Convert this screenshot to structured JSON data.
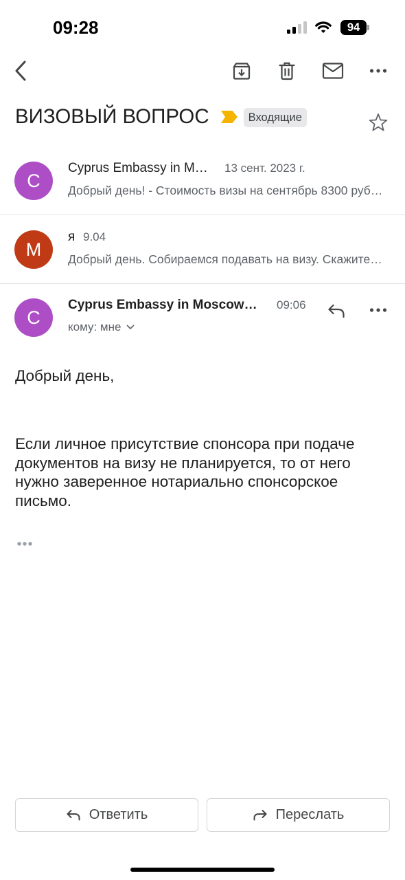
{
  "status_bar": {
    "time": "09:28",
    "battery_level": "94",
    "signal_icon": "cellular-signal-icon",
    "wifi_icon": "wifi-icon",
    "battery_icon": "battery-icon"
  },
  "toolbar": {
    "back_icon": "chevron-left-icon",
    "archive_icon": "archive-icon",
    "delete_icon": "trash-icon",
    "mark_unread_icon": "mail-icon",
    "more_icon": "more-horizontal-icon"
  },
  "thread": {
    "subject": "ВИЗОВЫЙ ВОПРОС",
    "importance_marker_color": "#f4b400",
    "label": "Входящие",
    "star_icon": "star-outline-icon",
    "starred": false
  },
  "messages": [
    {
      "avatar_letter": "C",
      "avatar_color": "#ad4ec6",
      "sender": "Cyprus Embassy in M…",
      "date": "13 сент. 2023 г.",
      "snippet": "Добрый день! - Стоимость визы на сентябрь 8300 руб…"
    },
    {
      "avatar_letter": "M",
      "avatar_color": "#c03a15",
      "sender": "я",
      "date": "9.04",
      "snippet": "Добрый день. Собираемся подавать на визу. Скажите…"
    }
  ],
  "open_message": {
    "avatar_letter": "C",
    "avatar_color": "#ad4ec6",
    "sender": "Cyprus Embassy in Moscow…",
    "time": "09:06",
    "recipient": "кому: мне",
    "reply_icon": "reply-icon",
    "more_icon": "more-horizontal-icon",
    "expand_recipients_icon": "chevron-down-icon",
    "greeting": "Добрый день,",
    "body_lines": [
      "Если личное присутствие спонсора при подаче",
      "документов на визу не планируется, то от него",
      "нужно заверенное нотариально спонсорское",
      "письмо."
    ],
    "trimmed_content_icon": "more-horizontal-icon"
  },
  "actions": {
    "reply_label": "Ответить",
    "reply_icon": "reply-icon",
    "forward_label": "Переслать",
    "forward_icon": "forward-icon"
  },
  "theme": {
    "text_primary": "#1f1f1f",
    "text_secondary": "#5f6368",
    "icon": "#444746",
    "divider": "#e3e3e3",
    "chip_bg": "#e8e8ea",
    "chip_text": "#3c4043",
    "button_border": "#d5d5d5"
  }
}
